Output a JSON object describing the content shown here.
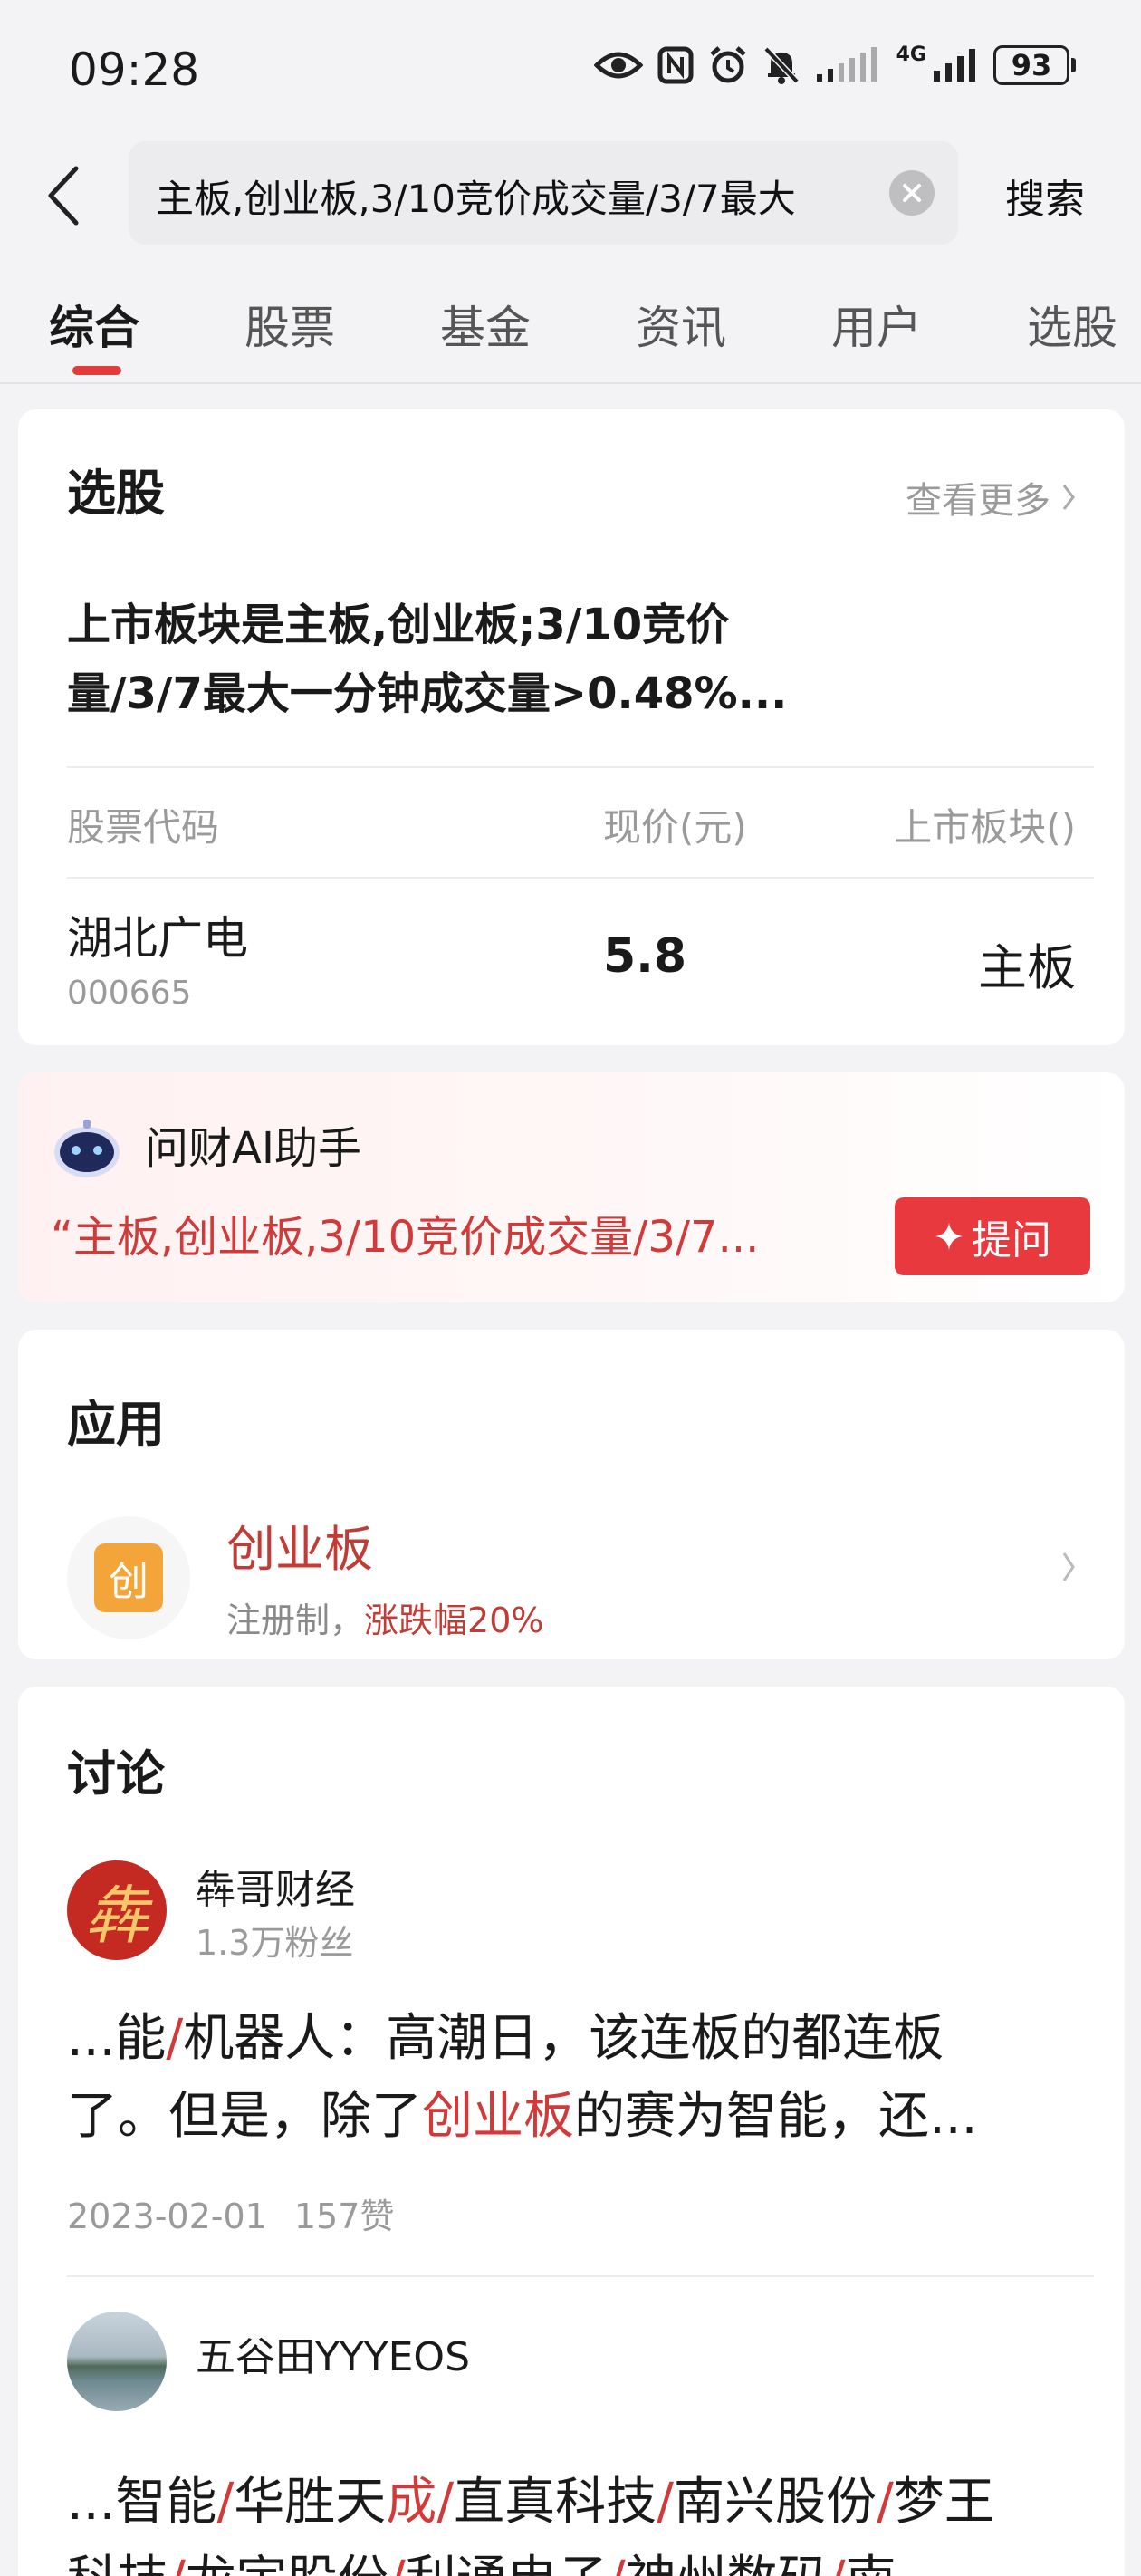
{
  "status_bar": {
    "time": "09:28",
    "network": "4G",
    "battery": "93"
  },
  "header": {
    "search_value": "主板,创业板,3/10竞价成交量/3/7最大",
    "search_button": "搜索"
  },
  "tabs": [
    {
      "label": "综合",
      "active": true
    },
    {
      "label": "股票"
    },
    {
      "label": "基金"
    },
    {
      "label": "资讯"
    },
    {
      "label": "用户"
    },
    {
      "label": "选股"
    }
  ],
  "stock_picker": {
    "title": "选股",
    "more": "查看更多",
    "query_line1": "上市板块是主板,创业板;3/10竞价",
    "query_line2": "量/3/7最大一分钟成交量>0.48%...",
    "columns": [
      "股票代码",
      "现价(元)",
      "上市板块()"
    ],
    "row": {
      "name": "湖北广电",
      "code": "000665",
      "price": "5.8",
      "board": "主板"
    }
  },
  "ai_assistant": {
    "title": "问财AI助手",
    "quote": "“主板,创业板,3/10竞价成交量/3/7...",
    "ask_button": "提问"
  },
  "apps": {
    "title": "应用",
    "item": {
      "icon_char": "创",
      "name": "创业板",
      "desc_prefix": "注册制，",
      "desc_highlight": "涨跌幅20%"
    }
  },
  "discussion": {
    "title": "讨论",
    "posts": [
      {
        "author": "犇哥财经",
        "avatar_char": "犇",
        "fans": "1.3万粉丝",
        "line1": [
          "...能",
          "/",
          "机器人：高潮日，该连板的都连板"
        ],
        "line2": [
          "了。但是，除了",
          "创业板",
          "的赛为智能，还..."
        ],
        "date": "2023-02-01",
        "likes": "157赞"
      },
      {
        "author": "五谷田YYYEOS",
        "line1": [
          "...智能",
          "/",
          "华胜天",
          "成",
          "/",
          "直真科技",
          "/",
          "南兴股份",
          "/",
          "梦王"
        ],
        "line2": [
          "科技",
          "/",
          "龙宇股份",
          "/",
          "利通电子",
          "/",
          "神州数码",
          "/",
          "南"
        ]
      }
    ]
  },
  "colors": {
    "accent_red": "#e8393f",
    "highlight_red": "#d23a3a",
    "app_orange": "#f3a53a"
  }
}
